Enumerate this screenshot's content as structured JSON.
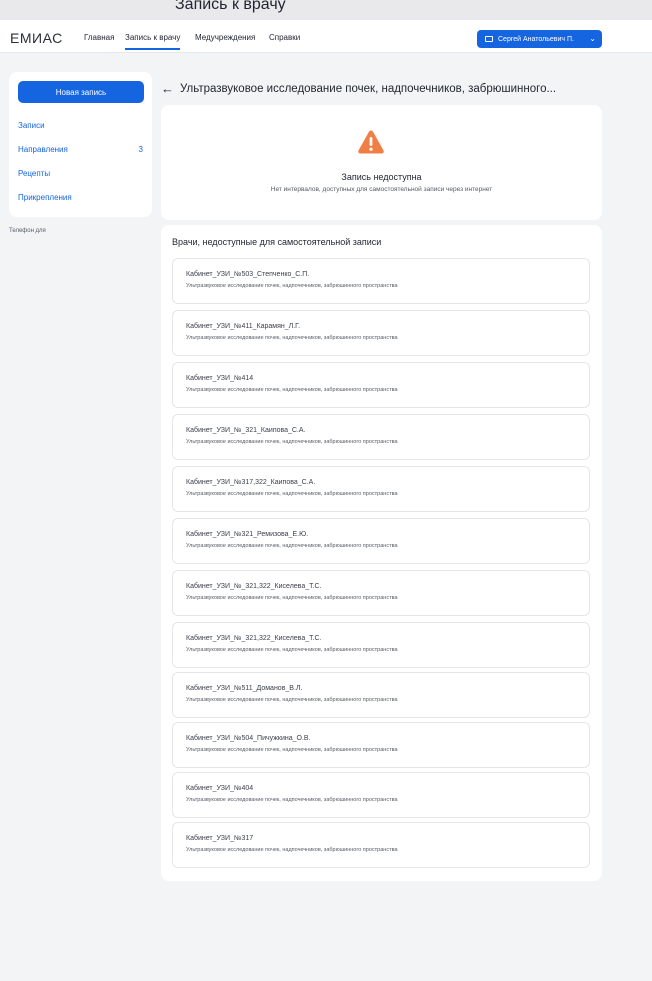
{
  "window": {
    "caption": "Запись к врачу"
  },
  "header": {
    "logo": "ЕМИАС",
    "nav": [
      {
        "label": "Главная"
      },
      {
        "label": "Запись к врачу",
        "active": true
      },
      {
        "label": "Медучреждения"
      },
      {
        "label": "Справки"
      }
    ],
    "user": {
      "name": "Сергей Анатольевич П."
    }
  },
  "sidebar": {
    "new_button": "Новая запись",
    "items": [
      {
        "label": "Записи"
      },
      {
        "label": "Направления",
        "count": "3"
      },
      {
        "label": "Рецепты"
      },
      {
        "label": "Прикрепления"
      }
    ],
    "phone_label": "Телефон для"
  },
  "main": {
    "title": "Ультразвуковое исследование почек, надпочечников, забрюшинного...",
    "unavailable": {
      "title": "Запись недоступна",
      "subtitle": "Нет интервалов, доступных для самостоятельной записи через интернет"
    },
    "doctors_heading": "Врачи, недоступные для самостоятельной записи",
    "doctors": [
      {
        "name": "Кабинет_УЗИ_№503_Степченко_С.П.",
        "service": "Ультразвуковое исследование почек, надпочечников, забрюшинного пространства"
      },
      {
        "name": "Кабинет_УЗИ_№411_Карамян_Л.Г.",
        "service": "Ультразвуковое исследование почек, надпочечников, забрюшинного пространства"
      },
      {
        "name": "Кабинет_УЗИ_№414",
        "service": "Ультразвуковое исследование почек, надпочечников, забрюшинного пространства"
      },
      {
        "name": "Кабинет_УЗИ_№_321_Каипова_С.А.",
        "service": "Ультразвуковое исследование почек, надпочечников, забрюшинного пространства"
      },
      {
        "name": "Кабинет_УЗИ_№317,322_Каипова_С.А.",
        "service": "Ультразвуковое исследование почек, надпочечников, забрюшинного пространства"
      },
      {
        "name": "Кабинет_УЗИ_№321_Ремизова_Е.Ю.",
        "service": "Ультразвуковое исследование почек, надпочечников, забрюшинного пространства"
      },
      {
        "name": "Кабинет_УЗИ_№_321,322_Киселева_Т.С.",
        "service": "Ультразвуковое исследование почек, надпочечников, забрюшинного пространства"
      },
      {
        "name": "Кабинет_УЗИ_№_321,322_Киселева_Т.С.",
        "service": "Ультразвуковое исследование почек, надпочечников, забрюшинного пространства"
      },
      {
        "name": "Кабинет_УЗИ_№511_Доманов_В.Л.",
        "service": "Ультразвуковое исследование почек, надпочечников, забрюшинного пространства"
      },
      {
        "name": "Кабинет_УЗИ_№504_Пичужкина_О.В.",
        "service": "Ультразвуковое исследование почек, надпочечников, забрюшинного пространства"
      },
      {
        "name": "Кабинет_УЗИ_№404",
        "service": "Ультразвуковое исследование почек, надпочечников, забрюшинного пространства"
      },
      {
        "name": "Кабинет_УЗИ_№317",
        "service": "Ультразвуковое исследование почек, надпочечников, забрюшинного пространства"
      }
    ]
  },
  "colors": {
    "accent": "#1565e0",
    "warning": "#f07f45"
  },
  "icons": {
    "back": "arrow-left-icon",
    "warning": "warning-triangle-icon",
    "user_card": "card-icon",
    "user_menu": "chevron-down-icon"
  }
}
